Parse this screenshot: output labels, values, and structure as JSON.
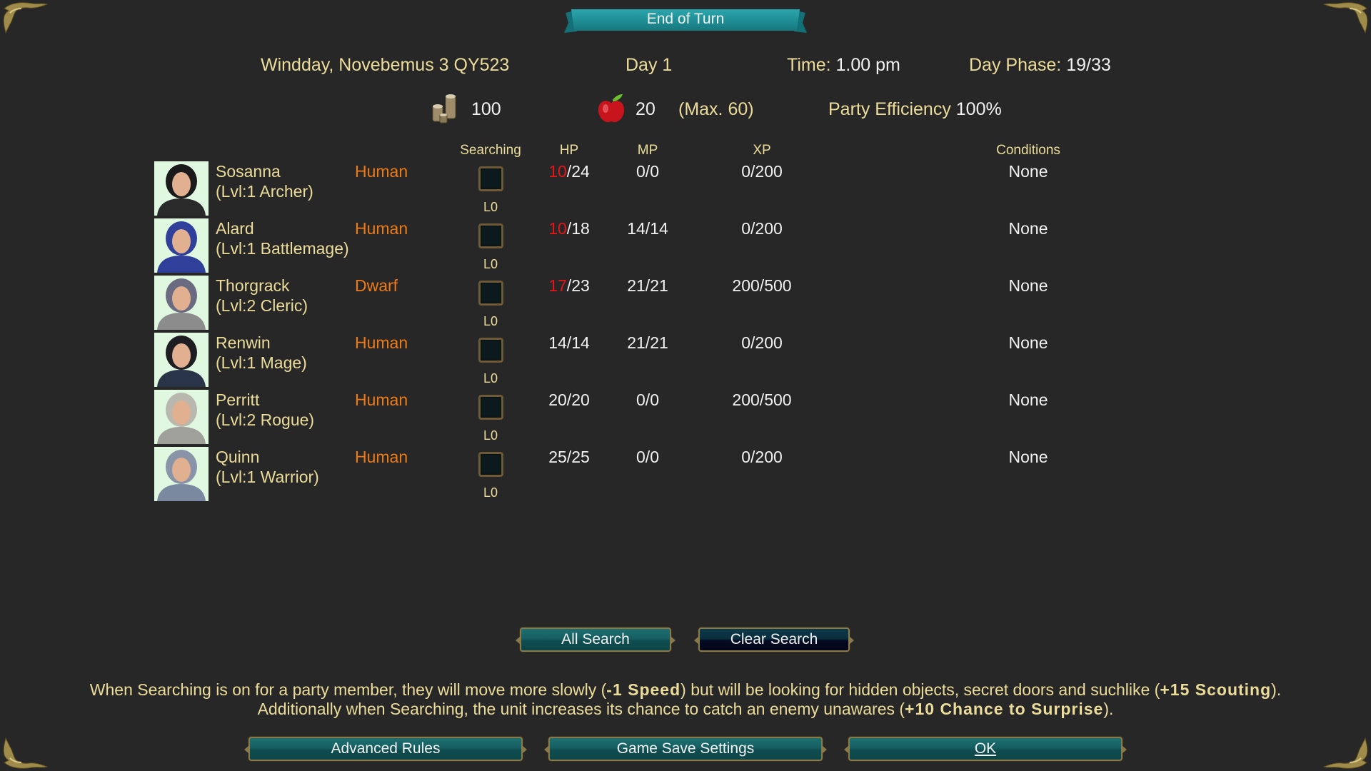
{
  "window": {
    "title": "End of Turn"
  },
  "header": {
    "date": "Windday, Novebemus 3 QY523",
    "day": "Day 1",
    "time_label": "Time:",
    "time_value": "1.00 pm",
    "day_phase_label": "Day Phase:",
    "day_phase_value": "19/33"
  },
  "resources": {
    "gold_icon": "coins-icon",
    "gold": "100",
    "food_icon": "apple-icon",
    "food": "20",
    "food_max": "(Max. 60)",
    "efficiency_label": "Party Efficiency",
    "efficiency_value": "100%"
  },
  "columns": {
    "searching": "Searching",
    "hp": "HP",
    "mp": "MP",
    "xp": "XP",
    "conditions": "Conditions"
  },
  "party": [
    {
      "name": "Sosanna",
      "class": "(Lvl:1 Archer)",
      "race": "Human",
      "searching": false,
      "search_level": "L0",
      "hp_current": "10",
      "hp_max": "/24",
      "hp_low": true,
      "mp": "0/0",
      "xp": "0/200",
      "conditions": "None",
      "portrait_color": "#2a2a2a"
    },
    {
      "name": "Alard",
      "class": "(Lvl:1 Battlemage)",
      "race": "Human",
      "searching": false,
      "search_level": "L0",
      "hp_current": "10",
      "hp_max": "/18",
      "hp_low": true,
      "mp": "14/14",
      "xp": "0/200",
      "conditions": "None",
      "portrait_color": "#2f3f9a"
    },
    {
      "name": "Thorgrack",
      "class": "(Lvl:2 Cleric)",
      "race": "Dwarf",
      "searching": false,
      "search_level": "L0",
      "hp_current": "17",
      "hp_max": "/23",
      "hp_low": true,
      "mp": "21/21",
      "xp": "200/500",
      "conditions": "None",
      "portrait_color": "#8c8c8c"
    },
    {
      "name": "Renwin",
      "class": "(Lvl:1 Mage)",
      "race": "Human",
      "searching": false,
      "search_level": "L0",
      "hp_current": "14",
      "hp_max": "/14",
      "hp_low": false,
      "mp": "21/21",
      "xp": "0/200",
      "conditions": "None",
      "portrait_color": "#2a3448"
    },
    {
      "name": "Perritt",
      "class": "(Lvl:2 Rogue)",
      "race": "Human",
      "searching": false,
      "search_level": "L0",
      "hp_current": "20",
      "hp_max": "/20",
      "hp_low": false,
      "mp": "0/0",
      "xp": "200/500",
      "conditions": "None",
      "portrait_color": "#a0a09a"
    },
    {
      "name": "Quinn",
      "class": "(Lvl:1 Warrior)",
      "race": "Human",
      "searching": false,
      "search_level": "L0",
      "hp_current": "25",
      "hp_max": "/25",
      "hp_low": false,
      "mp": "0/0",
      "xp": "0/200",
      "conditions": "None",
      "portrait_color": "#7a88a0"
    }
  ],
  "search_buttons": {
    "all": "All Search",
    "clear": "Clear Search"
  },
  "info": {
    "line1_a": "When Searching is on for a party member, they will move more slowly (",
    "line1_b": "-1 Speed",
    "line1_c": ") but will be looking for hidden objects, secret doors and suchlike (",
    "line1_d": "+15 Scouting",
    "line1_e": ").",
    "line2_a": "Additionally when Searching, the unit increases its chance to catch an enemy unawares (",
    "line2_b": "+10 Chance to Surprise",
    "line2_c": ")."
  },
  "footer": {
    "advanced_rules": "Advanced Rules",
    "game_save_settings": "Game Save Settings",
    "ok": "OK"
  },
  "colors": {
    "accent_gold": "#ecdc9a",
    "race_orange": "#ee7a16",
    "hp_low_red": "#e8141c",
    "button_teal": "#165f62"
  }
}
